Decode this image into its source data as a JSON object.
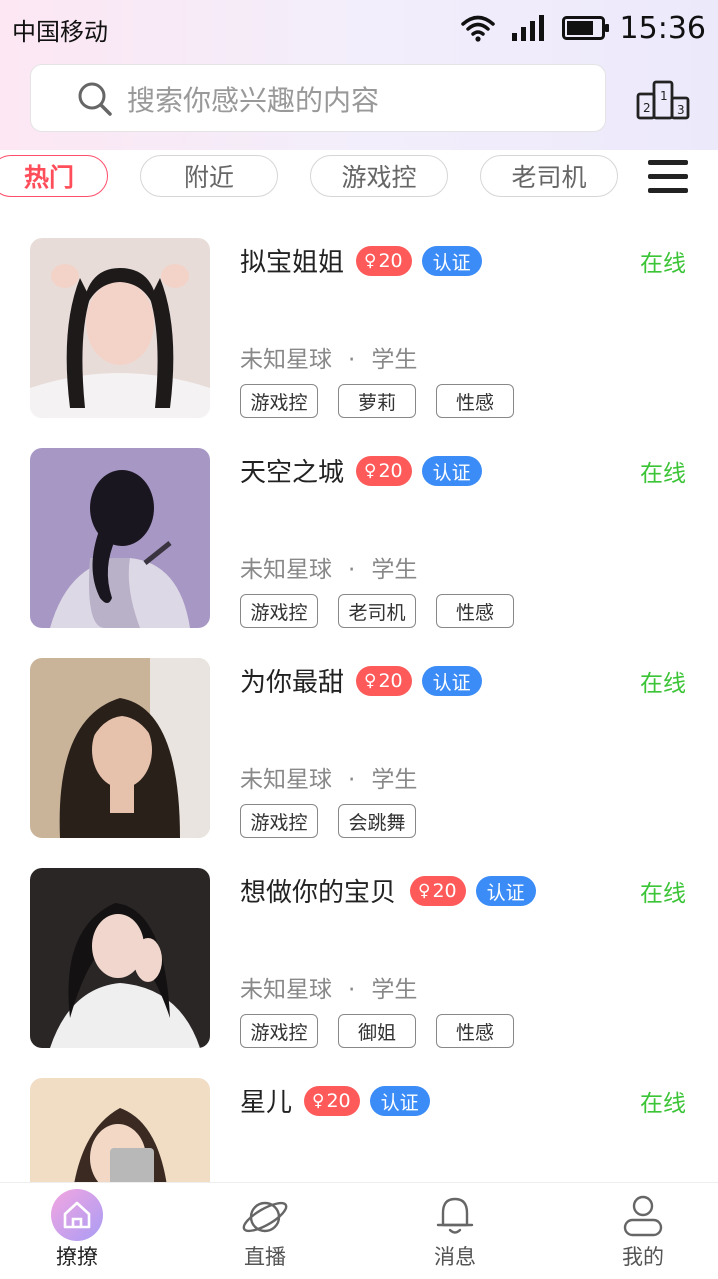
{
  "status_bar": {
    "carrier": "中国移动",
    "time": "15:36"
  },
  "search": {
    "placeholder": "搜索你感兴趣的内容",
    "value": ""
  },
  "category_tabs": [
    {
      "label": "热门",
      "active": true
    },
    {
      "label": "附近",
      "active": false
    },
    {
      "label": "游戏控",
      "active": false
    },
    {
      "label": "老司机",
      "active": false
    }
  ],
  "profiles": [
    {
      "name": "拟宝姐姐",
      "gender_symbol": "♀",
      "age": "20",
      "verify": "认证",
      "status": "在线",
      "location": "未知星球",
      "separator": "·",
      "occupation": "学生",
      "tags": [
        "游戏控",
        "萝莉",
        "性感"
      ]
    },
    {
      "name": "天空之城",
      "gender_symbol": "♀",
      "age": "20",
      "verify": "认证",
      "status": "在线",
      "location": "未知星球",
      "separator": "·",
      "occupation": "学生",
      "tags": [
        "游戏控",
        "老司机",
        "性感"
      ]
    },
    {
      "name": "为你最甜",
      "gender_symbol": "♀",
      "age": "20",
      "verify": "认证",
      "status": "在线",
      "location": "未知星球",
      "separator": "·",
      "occupation": "学生",
      "tags": [
        "游戏控",
        "会跳舞"
      ]
    },
    {
      "name": "想做你的宝贝",
      "gender_symbol": "♀",
      "age": "20",
      "verify": "认证",
      "status": "在线",
      "location": "未知星球",
      "separator": "·",
      "occupation": "学生",
      "tags": [
        "游戏控",
        "御姐",
        "性感"
      ]
    },
    {
      "name": "星儿",
      "gender_symbol": "♀",
      "age": "20",
      "verify": "认证",
      "status": "在线"
    }
  ],
  "bottom_nav": [
    {
      "label": "撩撩",
      "icon": "home-icon",
      "active": true
    },
    {
      "label": "直播",
      "icon": "planet-icon",
      "active": false
    },
    {
      "label": "消息",
      "icon": "bell-icon",
      "active": false
    },
    {
      "label": "我的",
      "icon": "user-icon",
      "active": false
    }
  ],
  "colors": {
    "accent_red": "#ff4d5a",
    "verify_blue": "#3b8cf7",
    "online_green": "#3cc437"
  }
}
